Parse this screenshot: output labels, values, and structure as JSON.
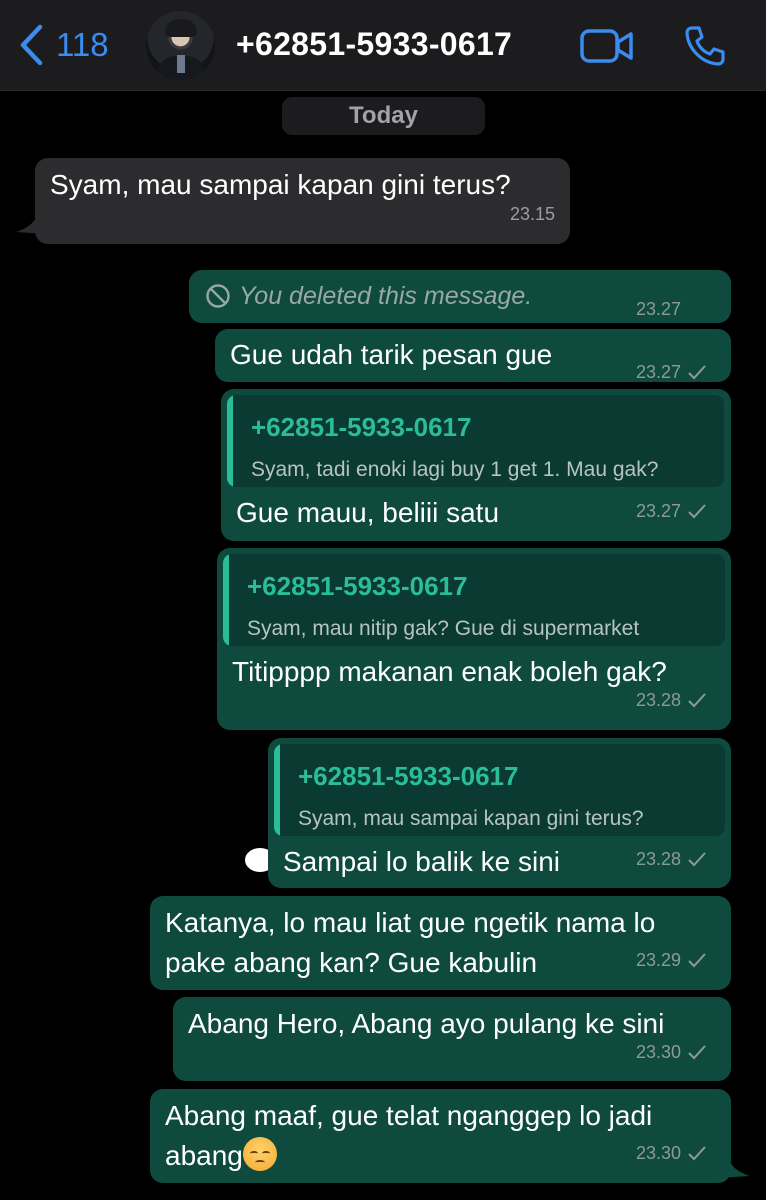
{
  "header": {
    "back_count": "118",
    "contact_name": "+62851-5933-0617",
    "icons": [
      "chevron-left-icon",
      "video-camera-icon",
      "phone-icon"
    ],
    "accent_color": "#3a8cf0"
  },
  "date_separator": "Today",
  "messages": [
    {
      "direction": "in",
      "text": "Syam, mau sampai kapan gini terus?",
      "time": "23.15"
    },
    {
      "direction": "out",
      "deleted": true,
      "text": "You deleted this message.",
      "time": "23.27"
    },
    {
      "direction": "out",
      "text": "Gue udah tarik pesan gue",
      "time": "23.27"
    },
    {
      "direction": "out",
      "reply_to": {
        "name": "+62851-5933-0617",
        "text": "Syam, tadi enoki lagi buy 1 get 1. Mau gak?"
      },
      "text": "Gue mauu, beliii satu",
      "time": "23.27"
    },
    {
      "direction": "out",
      "reply_to": {
        "name": "+62851-5933-0617",
        "text": "Syam, mau nitip gak? Gue di supermarket"
      },
      "text": "Titipppp makanan enak boleh gak?",
      "time": "23.28"
    },
    {
      "direction": "out",
      "reply_to": {
        "name": "+62851-5933-0617",
        "text": "Syam, mau sampai kapan gini terus?"
      },
      "text": "Sampai lo balik ke sini",
      "time": "23.28"
    },
    {
      "direction": "out",
      "lines": [
        "Katanya, lo mau liat gue ngetik nama lo",
        "pake abang kan? Gue kabulin"
      ],
      "time": "23.29"
    },
    {
      "direction": "out",
      "text": "Abang Hero, Abang ayo pulang ke sini",
      "time": "23.30"
    },
    {
      "direction": "out",
      "lines": [
        "Abang maaf, gue telat nganggep lo jadi",
        "abang"
      ],
      "emoji": "pensive-face-emoji",
      "time": "23.30"
    }
  ]
}
